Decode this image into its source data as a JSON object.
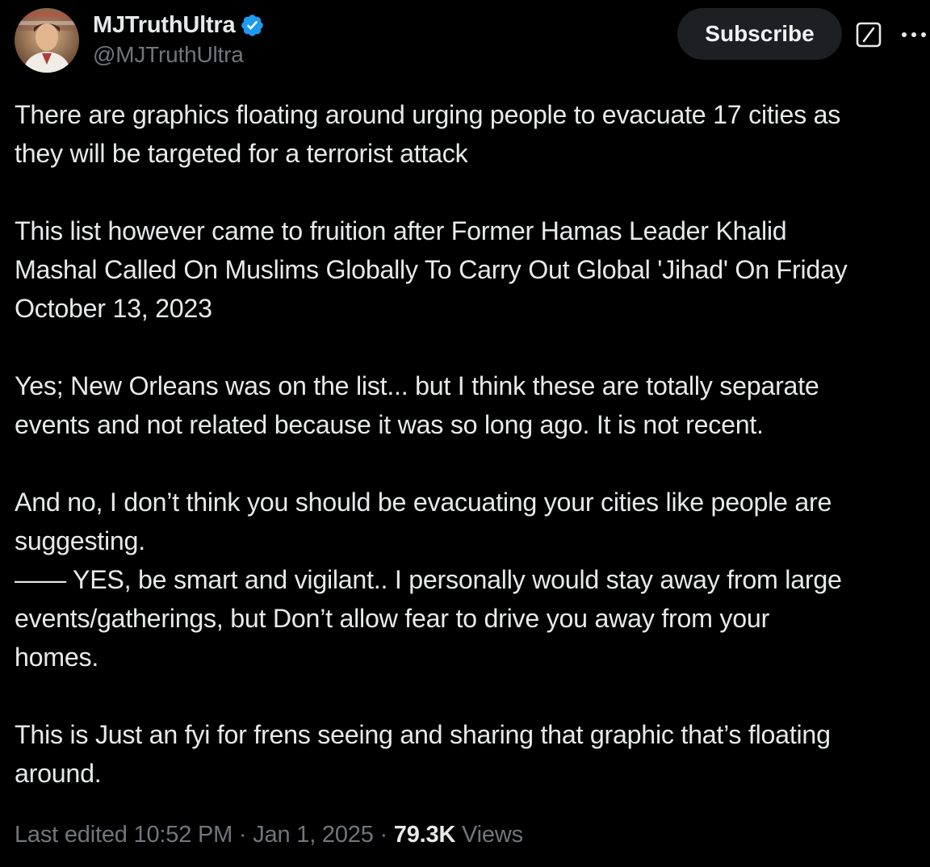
{
  "author": {
    "display_name": "MJTruthUltra",
    "handle": "@MJTruthUltra",
    "verified": true
  },
  "actions": {
    "subscribe_label": "Subscribe",
    "grok_icon": "grok-icon",
    "more_icon": "more-horizontal-icon"
  },
  "tweet": {
    "paragraphs": [
      [
        "There are graphics floating around urging people to evacuate 17 cities as",
        "they will be targeted for a terrorist attack"
      ],
      [
        "This list however came to fruition after Former Hamas Leader Khalid",
        "Mashal Called On Muslims Globally To Carry Out Global 'Jihad' On Friday",
        "October 13, 2023"
      ],
      [
        "Yes; New Orleans was on the list... but I think these are totally separate",
        "events and not related because it was so long ago. It is not recent."
      ],
      [
        "And no, I don’t think you should be evacuating your cities like people are",
        "suggesting.",
        "—— YES, be smart and vigilant.. I personally would stay away from large",
        "events/gatherings, but Don’t allow fear to drive you away from your",
        "homes."
      ],
      [
        "This is Just an fyi for frens seeing and sharing that graphic that’s floating",
        "around."
      ]
    ]
  },
  "meta": {
    "edited_prefix": "Last edited",
    "time": "10:52 PM",
    "separator": " · ",
    "date": "Jan 1, 2025",
    "views_count": "79.3K",
    "views_label": "Views"
  },
  "colors": {
    "background": "#000000",
    "text_primary": "#e7e9ea",
    "text_secondary": "#71767b",
    "verified_blue": "#1d9bf0",
    "subscribe_bg": "#1d1f23"
  }
}
